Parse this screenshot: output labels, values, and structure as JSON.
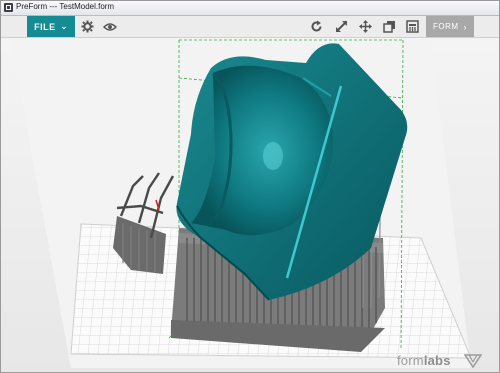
{
  "window": {
    "title": "PreForm --- TestModel.form"
  },
  "toolbar": {
    "file_label": "FILE",
    "form_label": "FORM",
    "icons_left": [
      "settings-icon",
      "eye-icon"
    ],
    "icons_right": [
      "rotate-icon",
      "scale-icon",
      "move-icon",
      "layers-icon",
      "print-icon"
    ]
  },
  "brand": {
    "prefix": "form",
    "suffix": "labs"
  },
  "colors": {
    "accent": "#158b93",
    "model": "#0e6b72",
    "supports": "#6f6f6f"
  }
}
